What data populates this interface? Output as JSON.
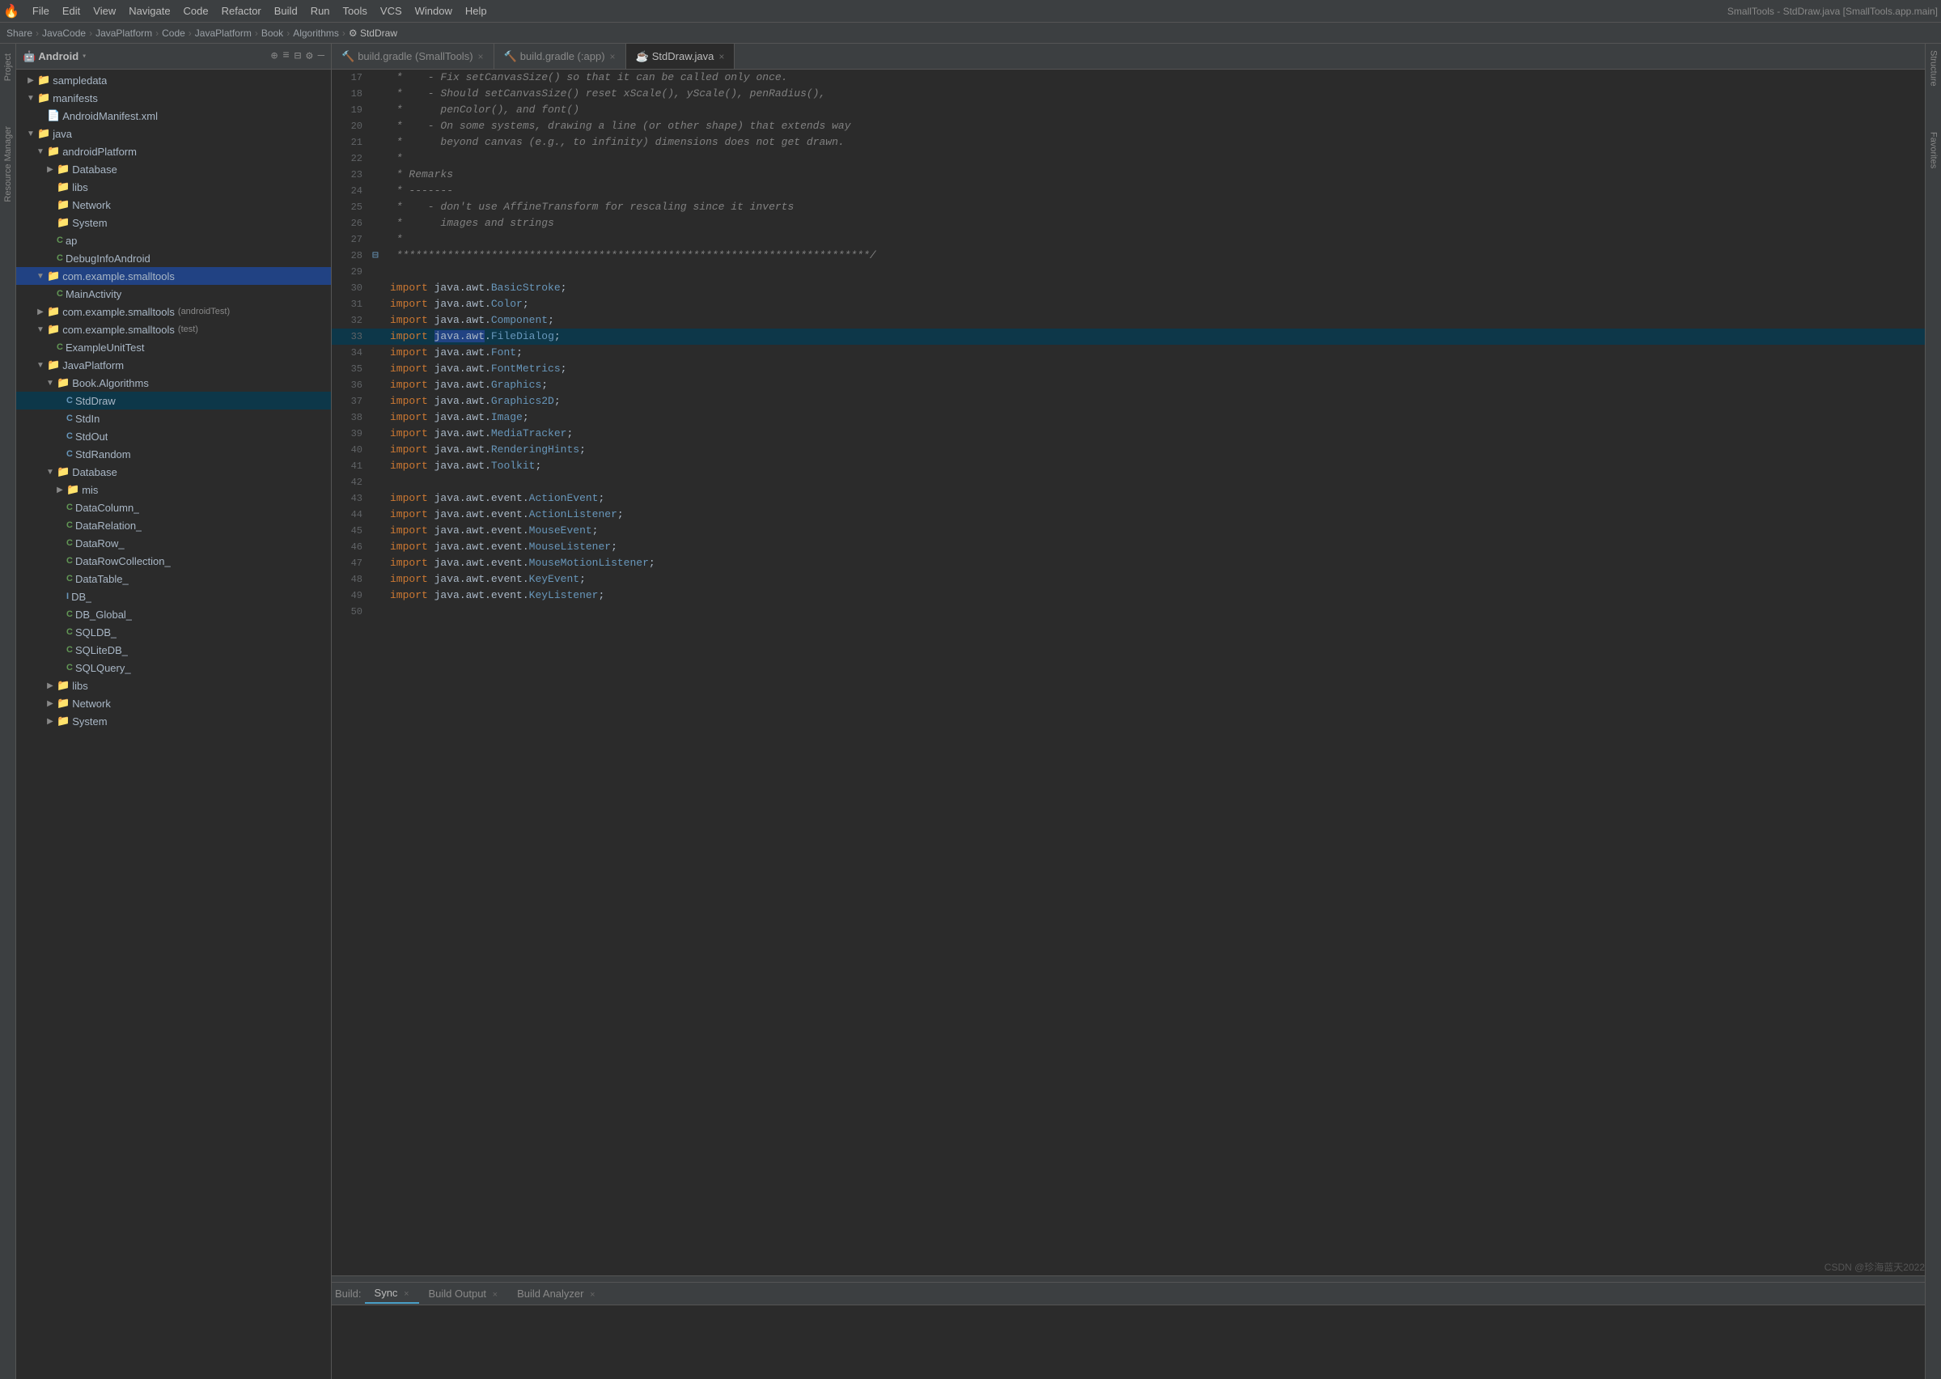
{
  "app": {
    "title": "SmallTools - StdDraw.java [SmallTools.app.main]",
    "logo": "🔥"
  },
  "menubar": {
    "items": [
      "File",
      "Edit",
      "View",
      "Navigate",
      "Code",
      "Refactor",
      "Build",
      "Run",
      "Tools",
      "VCS",
      "Window",
      "Help"
    ]
  },
  "breadcrumb": {
    "items": [
      "Share",
      "JavaCode",
      "JavaPlatform",
      "Code",
      "JavaPlatform",
      "Book",
      "Algorithms",
      "StdDraw"
    ]
  },
  "sidebar": {
    "title": "Android",
    "icons": [
      "⊕",
      "≡",
      "⊟",
      "⚙",
      "—"
    ]
  },
  "tree": {
    "items": [
      {
        "id": "sampledata",
        "label": "sampledata",
        "type": "folder",
        "indent": 1,
        "expanded": false
      },
      {
        "id": "manifests",
        "label": "manifests",
        "type": "folder",
        "indent": 1,
        "expanded": true
      },
      {
        "id": "androidmanifest",
        "label": "AndroidManifest.xml",
        "type": "xml",
        "indent": 2,
        "expanded": false
      },
      {
        "id": "java",
        "label": "java",
        "type": "folder",
        "indent": 1,
        "expanded": true
      },
      {
        "id": "androidplatform",
        "label": "androidPlatform",
        "type": "folder",
        "indent": 2,
        "expanded": true
      },
      {
        "id": "database",
        "label": "Database",
        "type": "folder",
        "indent": 3,
        "expanded": false
      },
      {
        "id": "libs",
        "label": "libs",
        "type": "folder",
        "indent": 3,
        "expanded": false
      },
      {
        "id": "network",
        "label": "Network",
        "type": "folder",
        "indent": 3,
        "expanded": false
      },
      {
        "id": "system",
        "label": "System",
        "type": "folder",
        "indent": 3,
        "expanded": false
      },
      {
        "id": "ap",
        "label": "ap",
        "type": "class",
        "indent": 3,
        "expanded": false
      },
      {
        "id": "debuginfoadroid",
        "label": "DebugInfoAndroid",
        "type": "class",
        "indent": 3,
        "expanded": false
      },
      {
        "id": "com-example",
        "label": "com.example.smalltools",
        "type": "folder",
        "indent": 2,
        "expanded": true
      },
      {
        "id": "mainactivity",
        "label": "MainActivity",
        "type": "class",
        "indent": 3,
        "expanded": false
      },
      {
        "id": "com-example-test",
        "label": "com.example.smalltools (androidTest)",
        "type": "folder",
        "indent": 2,
        "expanded": false
      },
      {
        "id": "com-example-test2",
        "label": "com.example.smalltools (test)",
        "type": "folder",
        "indent": 2,
        "expanded": true
      },
      {
        "id": "exampleunittest",
        "label": "ExampleUnitTest",
        "type": "class",
        "indent": 3,
        "expanded": false
      },
      {
        "id": "javaplatform",
        "label": "JavaPlatform",
        "type": "folder",
        "indent": 2,
        "expanded": true
      },
      {
        "id": "book-algorithms",
        "label": "Book.Algorithms",
        "type": "folder",
        "indent": 3,
        "expanded": true
      },
      {
        "id": "stddraw",
        "label": "StdDraw",
        "type": "class",
        "indent": 4,
        "expanded": false,
        "selected": true
      },
      {
        "id": "stdin",
        "label": "StdIn",
        "type": "class",
        "indent": 4,
        "expanded": false
      },
      {
        "id": "stdout",
        "label": "StdOut",
        "type": "class",
        "indent": 4,
        "expanded": false
      },
      {
        "id": "stdrandom",
        "label": "StdRandom",
        "type": "class",
        "indent": 4,
        "expanded": false
      },
      {
        "id": "database2",
        "label": "Database",
        "type": "folder",
        "indent": 3,
        "expanded": true
      },
      {
        "id": "mis",
        "label": "mis",
        "type": "folder",
        "indent": 4,
        "expanded": false
      },
      {
        "id": "datacolumn",
        "label": "DataColumn_",
        "type": "class",
        "indent": 4,
        "expanded": false
      },
      {
        "id": "datarelation",
        "label": "DataRelation_",
        "type": "class",
        "indent": 4,
        "expanded": false
      },
      {
        "id": "datarow",
        "label": "DataRow_",
        "type": "class",
        "indent": 4,
        "expanded": false
      },
      {
        "id": "datarowcollection",
        "label": "DataRowCollection_",
        "type": "class",
        "indent": 4,
        "expanded": false
      },
      {
        "id": "datatable",
        "label": "DataTable_",
        "type": "class",
        "indent": 4,
        "expanded": false
      },
      {
        "id": "db",
        "label": "DB_",
        "type": "interface",
        "indent": 4,
        "expanded": false
      },
      {
        "id": "db-global",
        "label": "DB_Global_",
        "type": "class",
        "indent": 4,
        "expanded": false
      },
      {
        "id": "sqldb",
        "label": "SQLDB_",
        "type": "class",
        "indent": 4,
        "expanded": false
      },
      {
        "id": "sqlitedb",
        "label": "SQLiteDB_",
        "type": "class",
        "indent": 4,
        "expanded": false
      },
      {
        "id": "sqlquery",
        "label": "SQLQuery_",
        "type": "class",
        "indent": 4,
        "expanded": false
      },
      {
        "id": "libs2",
        "label": "libs",
        "type": "folder",
        "indent": 3,
        "expanded": false
      },
      {
        "id": "network2",
        "label": "Network",
        "type": "folder",
        "indent": 3,
        "expanded": false
      },
      {
        "id": "system2",
        "label": "System",
        "type": "folder",
        "indent": 3,
        "expanded": false
      }
    ]
  },
  "editor": {
    "tabs": [
      {
        "id": "build-gradle-smalltools",
        "label": "build.gradle (SmallTools)",
        "type": "gradle",
        "active": false
      },
      {
        "id": "build-gradle-app",
        "label": "build.gradle (:app)",
        "type": "gradle",
        "active": false
      },
      {
        "id": "stddraw-java",
        "label": "StdDraw.java",
        "type": "java",
        "active": true
      }
    ]
  },
  "code": {
    "lines": [
      {
        "num": 17,
        "content": " *    - Fix setCanvasSize() so that it can be called only once.",
        "type": "comment"
      },
      {
        "num": 18,
        "content": " *    - Should setCanvasSize() reset xScale(), yScale(), penRadius(),",
        "type": "comment"
      },
      {
        "num": 19,
        "content": " *      penColor(), and font()",
        "type": "comment"
      },
      {
        "num": 20,
        "content": " *    - On some systems, drawing a line (or other shape) that extends way",
        "type": "comment"
      },
      {
        "num": 21,
        "content": " *      beyond canvas (e.g., to infinity) dimensions does not get drawn.",
        "type": "comment"
      },
      {
        "num": 22,
        "content": " *",
        "type": "comment"
      },
      {
        "num": 23,
        "content": " * Remarks",
        "type": "comment"
      },
      {
        "num": 24,
        "content": " * -------",
        "type": "comment"
      },
      {
        "num": 25,
        "content": " *    - don't use AffineTransform for rescaling since it inverts",
        "type": "comment"
      },
      {
        "num": 26,
        "content": " *      images and strings",
        "type": "comment"
      },
      {
        "num": 27,
        "content": " *",
        "type": "comment"
      },
      {
        "num": 28,
        "content": " ***************************************************************************/",
        "type": "comment",
        "fold": true
      },
      {
        "num": 29,
        "content": "",
        "type": "normal"
      },
      {
        "num": 30,
        "content": "import java.awt.BasicStroke;",
        "type": "import",
        "pkg": "java.awt.",
        "cls": "BasicStroke"
      },
      {
        "num": 31,
        "content": "import java.awt.Color;",
        "type": "import",
        "pkg": "java.awt.",
        "cls": "Color"
      },
      {
        "num": 32,
        "content": "import java.awt.Component;",
        "type": "import",
        "pkg": "java.awt.",
        "cls": "Component"
      },
      {
        "num": 33,
        "content": "import java.awt.FileDialog;",
        "type": "import",
        "pkg": "java.awt.",
        "cls": "FileDialog",
        "highlighted": true
      },
      {
        "num": 34,
        "content": "import java.awt.Font;",
        "type": "import",
        "pkg": "java.awt.",
        "cls": "Font"
      },
      {
        "num": 35,
        "content": "import java.awt.FontMetrics;",
        "type": "import",
        "pkg": "java.awt.",
        "cls": "FontMetrics"
      },
      {
        "num": 36,
        "content": "import java.awt.Graphics;",
        "type": "import",
        "pkg": "java.awt.",
        "cls": "Graphics"
      },
      {
        "num": 37,
        "content": "import java.awt.Graphics2D;",
        "type": "import",
        "pkg": "java.awt.",
        "cls": "Graphics2D"
      },
      {
        "num": 38,
        "content": "import java.awt.Image;",
        "type": "import",
        "pkg": "java.awt.",
        "cls": "Image"
      },
      {
        "num": 39,
        "content": "import java.awt.MediaTracker;",
        "type": "import",
        "pkg": "java.awt.",
        "cls": "MediaTracker"
      },
      {
        "num": 40,
        "content": "import java.awt.RenderingHints;",
        "type": "import",
        "pkg": "java.awt.",
        "cls": "RenderingHints"
      },
      {
        "num": 41,
        "content": "import java.awt.Toolkit;",
        "type": "import",
        "pkg": "java.awt.",
        "cls": "Toolkit"
      },
      {
        "num": 42,
        "content": "",
        "type": "normal"
      },
      {
        "num": 43,
        "content": "import java.awt.event.ActionEvent;",
        "type": "import",
        "pkg": "java.awt.event.",
        "cls": "ActionEvent"
      },
      {
        "num": 44,
        "content": "import java.awt.event.ActionListener;",
        "type": "import",
        "pkg": "java.awt.event.",
        "cls": "ActionListener"
      },
      {
        "num": 45,
        "content": "import java.awt.event.MouseEvent;",
        "type": "import",
        "pkg": "java.awt.event.",
        "cls": "MouseEvent"
      },
      {
        "num": 46,
        "content": "import java.awt.event.MouseListener;",
        "type": "import",
        "pkg": "java.awt.event.",
        "cls": "MouseListener"
      },
      {
        "num": 47,
        "content": "import java.awt.event.MouseMotionListener;",
        "type": "import",
        "pkg": "java.awt.event.",
        "cls": "MouseMotionListener"
      },
      {
        "num": 48,
        "content": "import java.awt.event.KeyEvent;",
        "type": "import",
        "pkg": "java.awt.event.",
        "cls": "KeyEvent"
      },
      {
        "num": 49,
        "content": "import java.awt.event.KeyListener;",
        "type": "import",
        "pkg": "java.awt.event.",
        "cls": "KeyListener"
      },
      {
        "num": 50,
        "content": "",
        "type": "normal"
      }
    ]
  },
  "bottom": {
    "tabs": [
      {
        "id": "build-sync",
        "label": "Build: Sync",
        "active": false
      },
      {
        "id": "build-output",
        "label": "Build Output",
        "active": false
      },
      {
        "id": "build-analyzer",
        "label": "Build Analyzer",
        "active": false
      }
    ],
    "prefix": "Build:"
  },
  "watermark": "CSDN @珍海蓝天2022",
  "right_strips": [
    "Structure",
    "Favorites"
  ]
}
